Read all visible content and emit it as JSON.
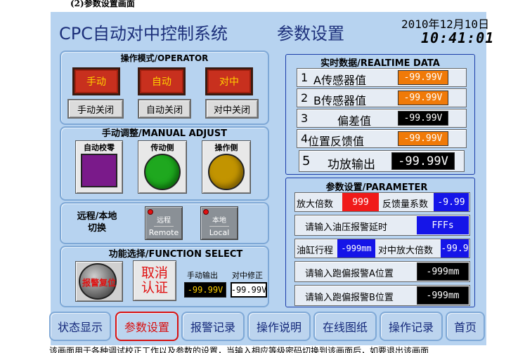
{
  "doc": {
    "heading": "(2)参数设置画面",
    "footer_text": "该画面用于各种调试校正工作以及参数的设置，当输入相应等级密码切换到该画面后，如要退出该画面"
  },
  "header": {
    "system_title": "CPC自动对中控制系统",
    "screen_title": "参数设置",
    "date": "2010年12月10日",
    "time": "10:41:01"
  },
  "operator": {
    "title": "操作模式/OPERATOR",
    "buttons": [
      {
        "label": "手动",
        "off_label": "手动关闭"
      },
      {
        "label": "自动",
        "off_label": "自动关闭"
      },
      {
        "label": "对中",
        "off_label": "对中关闭"
      }
    ]
  },
  "manual_adjust": {
    "title": "手动调整/MANUAL ADJUST",
    "buttons": [
      {
        "label": "自动校零",
        "color": "#7a1a8a"
      },
      {
        "label": "传动侧",
        "color": "#1fa81f"
      },
      {
        "label": "操作侧",
        "color": "#c29400"
      }
    ]
  },
  "remote_local": {
    "label_line1": "远程/本地",
    "label_line2": "切换",
    "remote": {
      "cn": "远程",
      "en": "Remote"
    },
    "local": {
      "cn": "本地",
      "en": "Local"
    }
  },
  "function_select": {
    "title": "功能选择/FUNCTION SELECT",
    "alarm_reset_label": "报警复位",
    "cancel_auth_label": "取消\n认证",
    "manual_output_label": "手动输出",
    "manual_output_value": "-99.99V",
    "center_correction_label": "对中修正",
    "center_correction_value": "-99.99V"
  },
  "realtime": {
    "title": "实时数据/REALTIME DATA",
    "rows": [
      {
        "index": "1",
        "label": "A传感器值",
        "value": "-99.99V",
        "color": "#f07a08"
      },
      {
        "index": "2",
        "label": "B传感器值",
        "value": "-99.99V",
        "color": "#f07a08"
      },
      {
        "index": "3",
        "label": "偏差值",
        "value": "-99.99V",
        "color": "#000000"
      },
      {
        "index": "4",
        "label": "位置反馈值",
        "value": "-99.99V",
        "color": "#f07a08"
      },
      {
        "index": "5",
        "label": "功放输出",
        "value": "-99.99V",
        "color": "#000000"
      }
    ]
  },
  "parameter": {
    "title": "参数设置/PARAMETER",
    "gain_label": "放大倍数",
    "gain_value": "999",
    "feedback_label": "反馈量系数",
    "feedback_value": "-9.99",
    "oil_delay_label": "请输入油压报警延时",
    "oil_delay_value": "FFFs",
    "cylinder_label": "油缸行程",
    "cylinder_value": "-999mm",
    "center_gain_label": "对中放大倍数",
    "center_gain_value": "-99.9",
    "deviation_a_label": "请输入跑偏报警A位置",
    "deviation_a_value": "-999mm",
    "deviation_b_label": "请输入跑偏报警B位置",
    "deviation_b_value": "-999mm"
  },
  "nav": {
    "items": [
      "状态显示",
      "参数设置",
      "报警记录",
      "操作说明",
      "在线图纸",
      "操作记录",
      "首页"
    ],
    "active_index": 1
  }
}
